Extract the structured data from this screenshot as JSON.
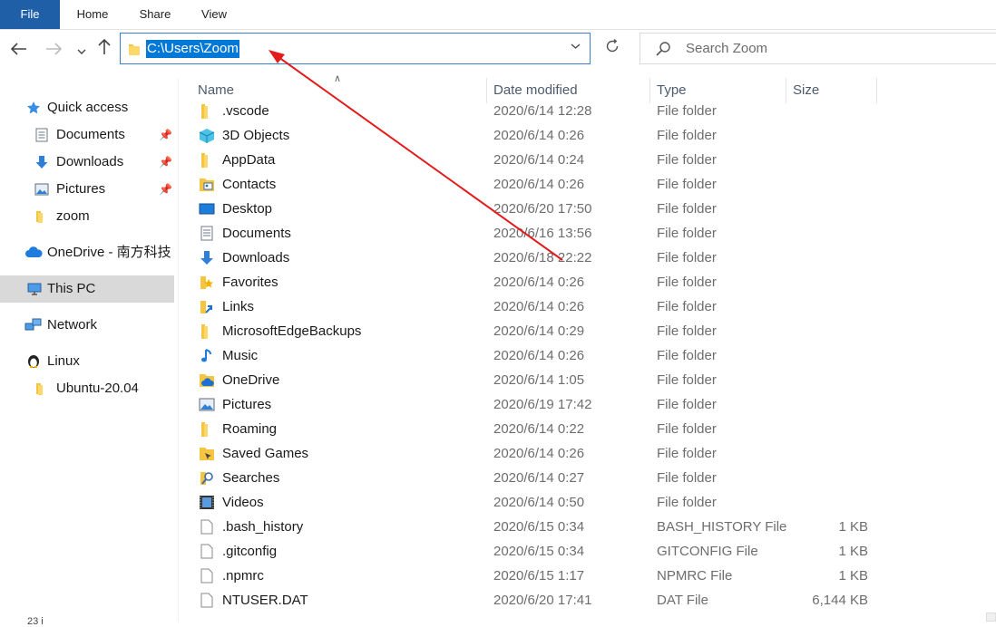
{
  "ribbon": {
    "tabs": [
      "File",
      "Home",
      "Share",
      "View"
    ]
  },
  "toolbar": {
    "back_icon": "arrow-left-icon",
    "forward_icon": "arrow-right-icon",
    "recent_icon": "chevron-down-icon",
    "up_icon": "arrow-up-icon",
    "refresh_icon": "refresh-icon"
  },
  "address": {
    "path": "C:\\Users\\Zoom",
    "selection_color": "#0078d7"
  },
  "search": {
    "placeholder": "Search Zoom"
  },
  "nav": {
    "items": [
      {
        "label": "Quick access",
        "icon": "star-icon"
      },
      {
        "label": "Documents",
        "icon": "documents-icon",
        "pinned": true
      },
      {
        "label": "Downloads",
        "icon": "download-icon",
        "pinned": true
      },
      {
        "label": "Pictures",
        "icon": "pictures-icon",
        "pinned": true
      },
      {
        "label": "zoom",
        "icon": "folder-icon"
      },
      {
        "label": "OneDrive - 南方科技",
        "icon": "cloud-icon"
      },
      {
        "label": "This PC",
        "icon": "computer-icon",
        "selected": true
      },
      {
        "label": "Network",
        "icon": "network-icon"
      },
      {
        "label": "Linux",
        "icon": "penguin-icon"
      },
      {
        "label": "Ubuntu-20.04",
        "icon": "folder-icon"
      }
    ]
  },
  "columns": {
    "name": "Name",
    "date": "Date modified",
    "type": "Type",
    "size": "Size"
  },
  "files": [
    {
      "name": ".vscode",
      "date": "2020/6/14 12:28",
      "type": "File folder",
      "size": "",
      "icon": "folder-icon"
    },
    {
      "name": "3D Objects",
      "date": "2020/6/14 0:26",
      "type": "File folder",
      "size": "",
      "icon": "cube-icon"
    },
    {
      "name": "AppData",
      "date": "2020/6/14 0:24",
      "type": "File folder",
      "size": "",
      "icon": "folder-icon"
    },
    {
      "name": "Contacts",
      "date": "2020/6/14 0:26",
      "type": "File folder",
      "size": "",
      "icon": "contacts-icon"
    },
    {
      "name": "Desktop",
      "date": "2020/6/20 17:50",
      "type": "File folder",
      "size": "",
      "icon": "desktop-icon"
    },
    {
      "name": "Documents",
      "date": "2020/6/16 13:56",
      "type": "File folder",
      "size": "",
      "icon": "documents-icon"
    },
    {
      "name": "Downloads",
      "date": "2020/6/18 22:22",
      "type": "File folder",
      "size": "",
      "icon": "download-icon"
    },
    {
      "name": "Favorites",
      "date": "2020/6/14 0:26",
      "type": "File folder",
      "size": "",
      "icon": "favorites-icon"
    },
    {
      "name": "Links",
      "date": "2020/6/14 0:26",
      "type": "File folder",
      "size": "",
      "icon": "links-icon"
    },
    {
      "name": "MicrosoftEdgeBackups",
      "date": "2020/6/14 0:29",
      "type": "File folder",
      "size": "",
      "icon": "folder-icon"
    },
    {
      "name": "Music",
      "date": "2020/6/14 0:26",
      "type": "File folder",
      "size": "",
      "icon": "music-icon"
    },
    {
      "name": "OneDrive",
      "date": "2020/6/14 1:05",
      "type": "File folder",
      "size": "",
      "icon": "onedrive-folder-icon"
    },
    {
      "name": "Pictures",
      "date": "2020/6/19 17:42",
      "type": "File folder",
      "size": "",
      "icon": "pictures-icon"
    },
    {
      "name": "Roaming",
      "date": "2020/6/14 0:22",
      "type": "File folder",
      "size": "",
      "icon": "folder-icon"
    },
    {
      "name": "Saved Games",
      "date": "2020/6/14 0:26",
      "type": "File folder",
      "size": "",
      "icon": "saved-games-icon"
    },
    {
      "name": "Searches",
      "date": "2020/6/14 0:27",
      "type": "File folder",
      "size": "",
      "icon": "searches-icon"
    },
    {
      "name": "Videos",
      "date": "2020/6/14 0:50",
      "type": "File folder",
      "size": "",
      "icon": "videos-icon"
    },
    {
      "name": ".bash_history",
      "date": "2020/6/15 0:34",
      "type": "BASH_HISTORY File",
      "size": "1 KB",
      "icon": "file-icon"
    },
    {
      "name": ".gitconfig",
      "date": "2020/6/15 0:34",
      "type": "GITCONFIG File",
      "size": "1 KB",
      "icon": "file-icon"
    },
    {
      "name": ".npmrc",
      "date": "2020/6/15 1:17",
      "type": "NPMRC File",
      "size": "1 KB",
      "icon": "file-icon"
    },
    {
      "name": "NTUSER.DAT",
      "date": "2020/6/20 17:41",
      "type": "DAT File",
      "size": "6,144 KB",
      "icon": "file-icon"
    }
  ],
  "status": {
    "text": "23 i"
  },
  "annotation": {
    "arrow_color": "#e31b1b"
  }
}
